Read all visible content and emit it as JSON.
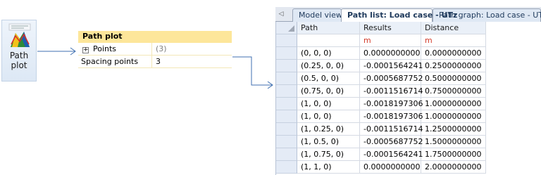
{
  "ribbon": {
    "path_plot_label": "Path\nplot"
  },
  "panel": {
    "title": "Path plot",
    "rows": [
      {
        "label": "Points",
        "value": "(3)",
        "expander": "+"
      },
      {
        "label": "Spacing points",
        "value": "3"
      }
    ]
  },
  "tabs": [
    {
      "label": "Model view",
      "active": false
    },
    {
      "label": "Path list: Load case - UTz",
      "active": true
    },
    {
      "label": "Path graph: Load case - UTz",
      "active": false
    }
  ],
  "grid": {
    "columns": [
      "Path",
      "Results",
      "Distance"
    ],
    "units": [
      "",
      "m",
      "m"
    ],
    "rows": [
      [
        "(0, 0, 0)",
        "0.0000000000",
        "0.0000000000"
      ],
      [
        "(0.25, 0, 0)",
        "-0.0001564241",
        "0.2500000000"
      ],
      [
        "(0.5, 0, 0)",
        "-0.0005687752",
        "0.5000000000"
      ],
      [
        "(0.75, 0, 0)",
        "-0.0011516714",
        "0.7500000000"
      ],
      [
        "(1, 0, 0)",
        "-0.0018197306",
        "1.0000000000"
      ],
      [
        "(1, 0, 0)",
        "-0.0018197306",
        "1.0000000000"
      ],
      [
        "(1, 0.25, 0)",
        "-0.0011516714",
        "1.2500000000"
      ],
      [
        "(1, 0.5, 0)",
        "-0.0005687752",
        "1.5000000000"
      ],
      [
        "(1, 0.75, 0)",
        "-0.0001564241",
        "1.7500000000"
      ],
      [
        "(1, 1, 0)",
        "0.0000000000",
        "2.0000000000"
      ]
    ]
  },
  "colors": {
    "panel_header": "#fde69a",
    "unit_text": "#d23b2a",
    "connector": "#3f6fb0"
  }
}
